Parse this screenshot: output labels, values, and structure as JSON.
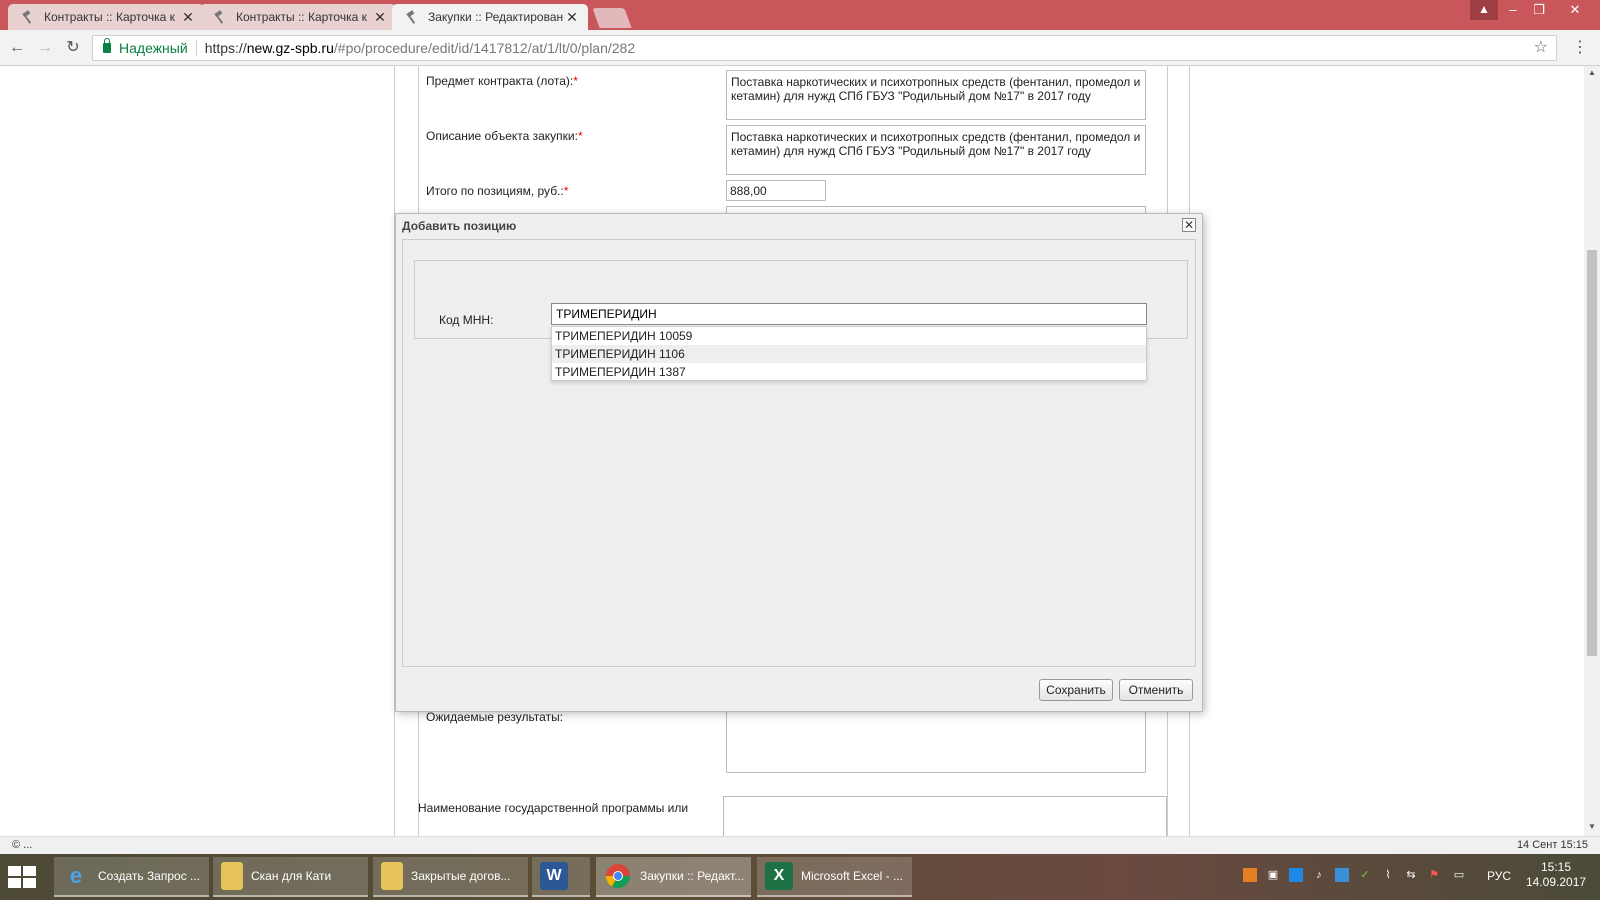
{
  "browser": {
    "tabs": [
      {
        "title": "Контракты :: Карточка к",
        "active": false
      },
      {
        "title": "Контракты :: Карточка к",
        "active": false
      },
      {
        "title": "Закупки :: Редактирован",
        "active": true
      }
    ],
    "security_label": "Надежный",
    "url_scheme": "https://",
    "url_host": "new.gz-spb.ru",
    "url_path": "/#po/procedure/edit/id/1417812/at/1/lt/0/plan/282"
  },
  "form": {
    "subject_label": "Предмет контракта (лота):",
    "subject_value": "Поставка наркотических и психотропных средств (фентанил, промедол и кетамин) для нужд СПб ГБУЗ \"Родильный дом №17\" в 2017 году",
    "description_label": "Описание объекта закупки:",
    "description_value": "Поставка наркотических и психотропных средств (фентанил, промедол и кетамин) для нужд СПб ГБУЗ \"Родильный дом №17\" в 2017 году",
    "total_label": "Итого по позициям, руб.:",
    "total_value": "888,00",
    "required_mark": "*",
    "expected_label": "Ожидаемые результаты:",
    "program_label": "Наименование государственной программы или"
  },
  "modal": {
    "title": "Добавить позицию",
    "mnn_label": "Код МНН:",
    "mnn_value": "ТРИМЕПЕРИДИН",
    "suggestions": [
      "ТРИМЕПЕРИДИН 10059",
      "ТРИМЕПЕРИДИН 1106",
      "ТРИМЕПЕРИДИН 1387"
    ],
    "save_label": "Сохранить",
    "cancel_label": "Отменить"
  },
  "statusbar": {
    "left": "© ...",
    "right": "14 Сент 15:15"
  },
  "taskbar": {
    "items": [
      {
        "label": "Создать Запрос ...",
        "icon": "ie-icon"
      },
      {
        "label": "Скан для Кати",
        "icon": "folder-icon"
      },
      {
        "label": "Закрытые догов...",
        "icon": "folder-icon"
      },
      {
        "label": "",
        "icon": "word-icon"
      },
      {
        "label": "Закупки :: Редакт...",
        "icon": "chrome-icon"
      },
      {
        "label": "Microsoft Excel - ...",
        "icon": "excel-icon"
      }
    ],
    "language": "РУС",
    "time": "15:15",
    "date": "14.09.2017"
  }
}
